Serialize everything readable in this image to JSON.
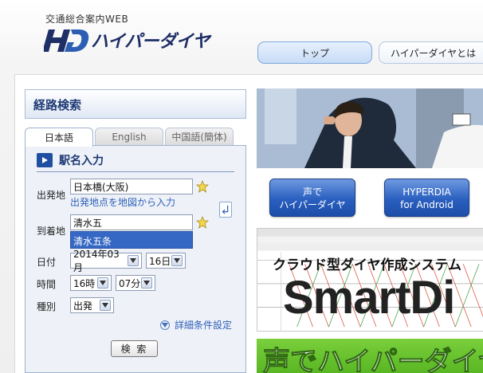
{
  "header": {
    "subtitle": "交通総合案内WEB",
    "logo_text": "ハイパーダイヤ",
    "nav": [
      {
        "label": "トップ"
      },
      {
        "label": "ハイパーダイヤとは"
      }
    ]
  },
  "search_panel": {
    "title": "経路検索",
    "languages": [
      "日本語",
      "English",
      "中国語(簡体)"
    ],
    "section_title": "駅名入力",
    "from": {
      "label": "出発地",
      "value": "日本橋(大阪)",
      "map_link": "出発地点を地図から入力"
    },
    "to": {
      "label": "到着地",
      "value": "清水五"
    },
    "suggestion": "清水五条",
    "date": {
      "label": "日付",
      "month": "2014年03月",
      "day": "16日"
    },
    "time": {
      "label": "時間",
      "hour": "16時",
      "minute": "07分"
    },
    "type": {
      "label": "種別",
      "value": "出発"
    },
    "detail_link": "詳細条件設定",
    "search_button": "検 索"
  },
  "promos": {
    "voice": {
      "line1": "声で",
      "line2": "ハイパーダイヤ"
    },
    "android": {
      "line1": "HYPERDIA",
      "line2": "for Android"
    },
    "smartdia": {
      "catch": "クラウド型ダイヤ作成システム",
      "logo": "SmartDi"
    },
    "voice_banner": "声でハイパーダイヤ"
  },
  "colors": {
    "accent": "#1f3a74",
    "suggest_bg": "#3568c4",
    "link": "#2f5fb8"
  }
}
